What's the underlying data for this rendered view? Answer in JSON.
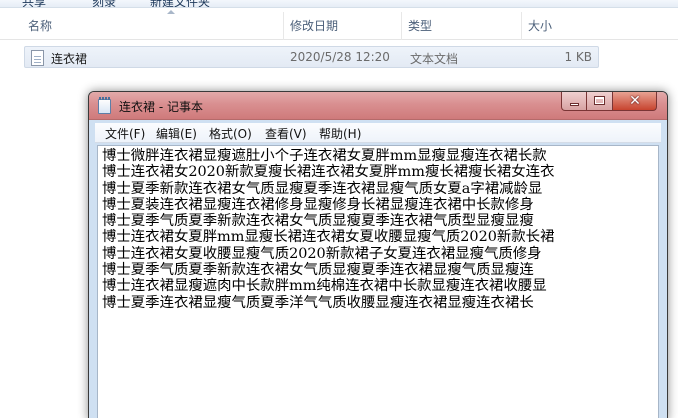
{
  "explorer": {
    "toolbar": {
      "item1": "共享",
      "item2": "刻录",
      "item3": "新建文件夹"
    },
    "columns": {
      "name": "名称",
      "date": "修改日期",
      "type": "类型",
      "size": "大小"
    },
    "file": {
      "name": "连衣裙",
      "date": "2020/5/28 12:20",
      "type": "文本文档",
      "size": "1 KB"
    }
  },
  "notepad": {
    "title": "连衣裙 - 记事本",
    "menu": {
      "file": "文件(F)",
      "edit": "编辑(E)",
      "format": "格式(O)",
      "view": "查看(V)",
      "help": "帮助(H)"
    },
    "lines": [
      "博士微胖连衣裙显瘦遮肚小个子连衣裙女夏胖mm显瘦显瘦连衣裙长款",
      "博士连衣裙女2020新款夏瘦长裙连衣裙女夏胖mm瘦长裙瘦长裙女连衣",
      "博士夏季新款连衣裙女气质显瘦夏季连衣裙显瘦气质女夏a字裙减龄显",
      "博士夏装连衣裙显瘦连衣裙修身显瘦修身长裙显瘦连衣裙中长款修身",
      "博士夏季气质夏季新款连衣裙女气质显瘦夏季连衣裙气质型显瘦显瘦",
      "博士连衣裙女夏胖mm显瘦长裙连衣裙女夏收腰显瘦气质2020新款长裙",
      "博士连衣裙女夏收腰显瘦气质2020新款裙子女夏连衣裙显瘦气质修身",
      "博士夏季气质夏季新款连衣裙女气质显瘦夏季连衣裙显瘦气质显瘦连",
      "博士连衣裙显瘦遮肉中长款胖mm纯棉连衣裙中长款显瘦连衣裙收腰显",
      "博士夏季连衣裙显瘦气质夏季洋气气质收腰显瘦连衣裙显瘦连衣裙长"
    ]
  },
  "colors": {
    "titlebar": "#d98f90",
    "close_button": "#c7442f",
    "window_frame": "#cfe0f2"
  }
}
